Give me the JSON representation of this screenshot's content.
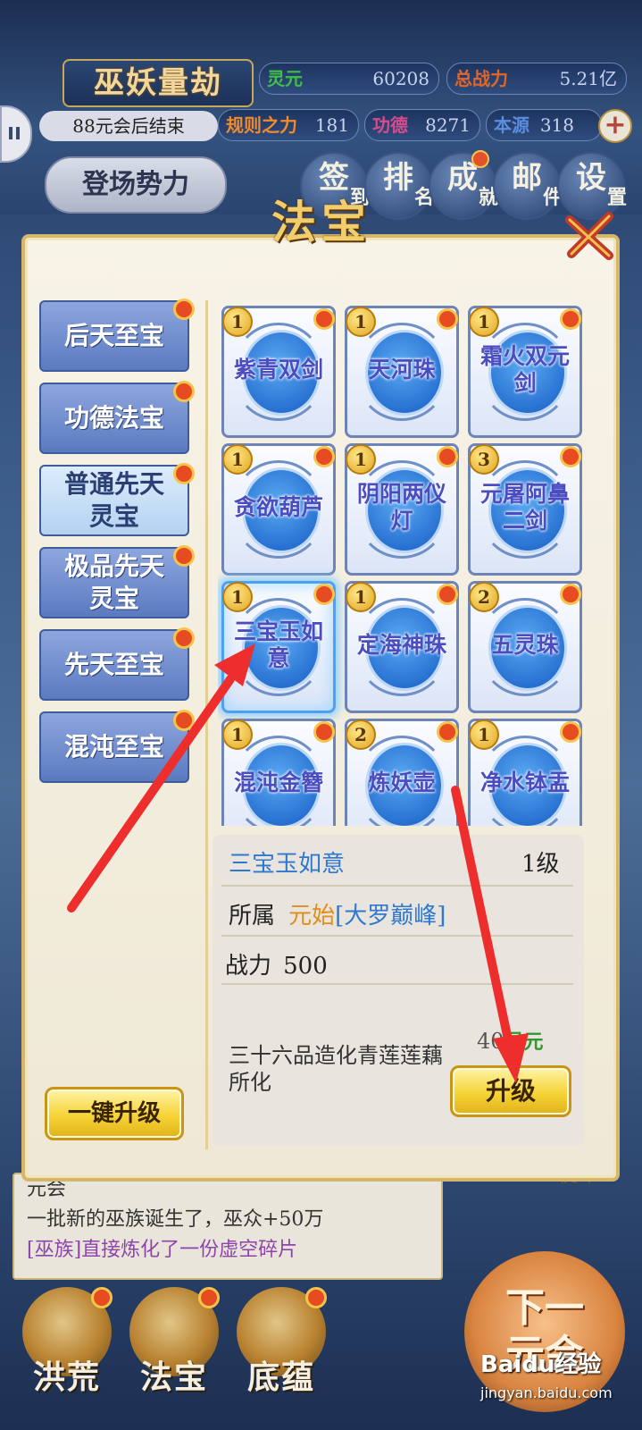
{
  "header": {
    "title": "巫妖量劫",
    "end_note": "88元会后结束",
    "stats": [
      {
        "label": "灵元",
        "value": "60208",
        "color": "#3fbf4a"
      },
      {
        "label": "总战力",
        "value": "5.21亿",
        "color": "#e0672a"
      },
      {
        "label": "规则之力",
        "value": "181",
        "color": "#f08a2b"
      },
      {
        "label": "功德",
        "value": "8271",
        "color": "#d74c8f"
      },
      {
        "label": "本源",
        "value": "318",
        "color": "#5a8fe0"
      }
    ],
    "faction_button": "登场势力",
    "top_icons": [
      {
        "main": "签",
        "sub": "到"
      },
      {
        "main": "排",
        "sub": "名"
      },
      {
        "main": "成",
        "sub": "就"
      },
      {
        "main": "邮",
        "sub": "件"
      },
      {
        "main": "设",
        "sub": "置"
      }
    ]
  },
  "panel": {
    "title": "法宝",
    "categories": [
      "后天至宝",
      "功德法宝",
      "普通先天灵宝",
      "极品先天灵宝",
      "先天至宝",
      "混沌至宝"
    ],
    "active_category": "普通先天灵宝",
    "treasures": [
      {
        "name": "紫青双剑",
        "level": "1"
      },
      {
        "name": "天河珠",
        "level": "1"
      },
      {
        "name": "霜火双元剑",
        "level": "1"
      },
      {
        "name": "贪欲葫芦",
        "level": "1"
      },
      {
        "name": "阴阳两仪灯",
        "level": "1"
      },
      {
        "name": "元屠阿鼻二剑",
        "level": "3"
      },
      {
        "name": "三宝玉如意",
        "level": "1"
      },
      {
        "name": "定海神珠",
        "level": "1"
      },
      {
        "name": "五灵珠",
        "level": "2"
      },
      {
        "name": "混沌金簪",
        "level": "1"
      },
      {
        "name": "炼妖壶",
        "level": "2"
      },
      {
        "name": "净水钵盂",
        "level": "1"
      }
    ],
    "selected_index": 6,
    "one_click_upgrade": "一键升级",
    "detail": {
      "name": "三宝玉如意",
      "level": "1级",
      "belong_label": "所属",
      "belong_owner": "元始",
      "belong_place": "[大罗巅峰]",
      "power_label": "战力",
      "power_value": "500",
      "description": "三十六品造化青莲莲藕所化",
      "cost_amount": "40",
      "cost_currency": "灵元",
      "upgrade_label": "升级"
    }
  },
  "log": {
    "lines": [
      "元会",
      "一批新的巫族诞生了，巫众+50万",
      "[巫族]直接炼化了一份虚空碎片"
    ],
    "side_label": "使命"
  },
  "bottom_nav": [
    "洪荒",
    "法宝",
    "底蕴"
  ],
  "next_button": "下一元会",
  "watermark": {
    "brand": "Baidu经验",
    "url": "jingyan.baidu.com"
  }
}
